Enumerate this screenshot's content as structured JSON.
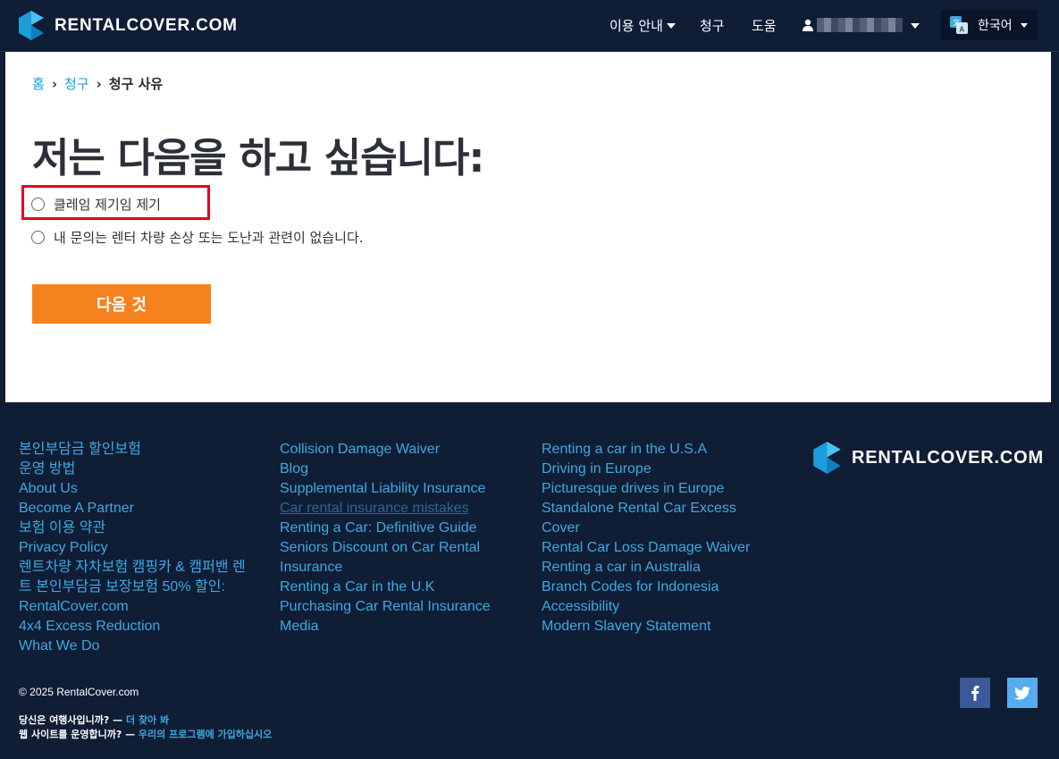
{
  "header": {
    "brand": "RENTALCOVER.COM",
    "nav": {
      "usage_guide": "이용 안내",
      "claims": "청구",
      "help": "도움"
    },
    "language": "한국어"
  },
  "breadcrumb": {
    "home": "홈",
    "claims": "청구",
    "current": "청구 사유",
    "separator": "›"
  },
  "main": {
    "title": "저는 다음을 하고 싶습니다:",
    "options": [
      {
        "label": "클레임 제기임 제기",
        "selected": false
      },
      {
        "label": "내 문의는 렌터 차량 손상 또는 도난과 관련이 없습니다.",
        "selected": false
      }
    ],
    "next_button": "다음 것"
  },
  "footer": {
    "col1": [
      "본인부담금 할인보험",
      "운영 방법",
      "About Us",
      "Become A Partner",
      "보험 이용 약관",
      "Privacy Policy",
      "렌트차량 자차보험 캠핑카 & 캠퍼밴 렌",
      "트 본인부담금 보장보험 50% 할인:",
      "RentalCover.com",
      "4x4 Excess Reduction",
      "What We Do"
    ],
    "col2": [
      "Collision Damage Waiver",
      "Blog",
      "Supplemental Liability Insurance",
      "Car rental insurance mistakes",
      "Renting a Car: Definitive Guide",
      "Seniors Discount on Car Rental",
      "Insurance",
      "Renting a Car in the U.K",
      "Purchasing Car Rental Insurance",
      "Media"
    ],
    "col3": [
      "Renting a car in the U.S.A",
      "Driving in Europe",
      "Picturesque drives in Europe",
      "Standalone Rental Car Excess",
      "Cover",
      "Rental Car Loss Damage Waiver",
      "Renting a car in Australia",
      "Branch Codes for Indonesia",
      "Accessibility",
      "Modern Slavery Statement"
    ],
    "brand": "RENTALCOVER.COM",
    "copyright": "© 2025 RentalCover.com",
    "travel_q": "당신은 여행사입니까? — ",
    "travel_link": "더 찾아 봐",
    "web_q": "웹 사이트를 운영합니까? — ",
    "web_link": "우리의 프로그램에 가입하십시오"
  },
  "colors": {
    "navy": "#0f1d35",
    "accent_blue": "#1a9dd9",
    "orange": "#f5821f",
    "highlight_red": "#e8001f",
    "facebook": "#3b5998",
    "twitter": "#55acee"
  },
  "icons": [
    "logo-icon",
    "user-icon",
    "translate-icon",
    "facebook-icon",
    "twitter-icon"
  ]
}
